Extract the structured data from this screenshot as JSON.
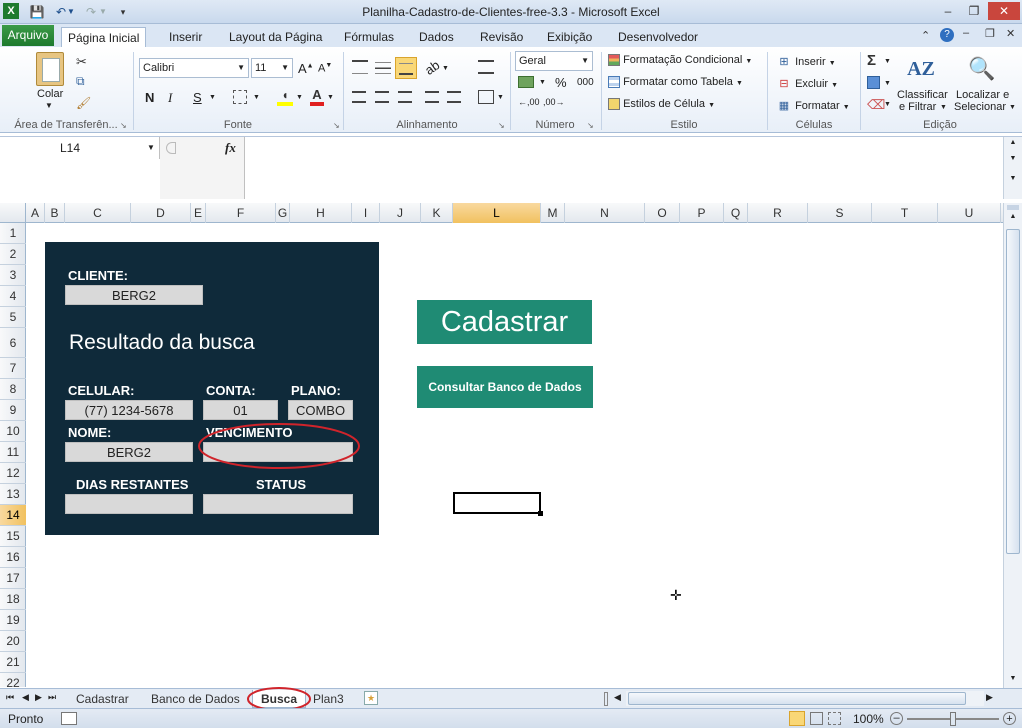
{
  "window": {
    "title": "Planilha-Cadastro-de-Clientes-free-3.3  -  Microsoft Excel",
    "minimize": "–",
    "restore": "❐",
    "close": "✕"
  },
  "ribbon_tabs": [
    "Página Inicial",
    "Inserir",
    "Layout da Página",
    "Fórmulas",
    "Dados",
    "Revisão",
    "Exibição",
    "Desenvolvedor"
  ],
  "file_tab": "Arquivo",
  "ribbon": {
    "clipboard": {
      "paste": "Colar",
      "label": "Área de Transferên..."
    },
    "font": {
      "name": "Calibri",
      "size": "11",
      "bold": "N",
      "italic": "I",
      "underline": "S",
      "label": "Fonte"
    },
    "alignment": {
      "label": "Alinhamento"
    },
    "number": {
      "format": "Geral",
      "percent": "%",
      "thousands": "000",
      "label": "Número"
    },
    "styles": {
      "conditional": "Formatação Condicional",
      "table": "Formatar como Tabela",
      "cell": "Estilos de Célula",
      "label": "Estilo"
    },
    "cells": {
      "insert": "Inserir",
      "delete": "Excluir",
      "format": "Formatar",
      "label": "Células"
    },
    "editing": {
      "sort1": "Classificar",
      "sort2": "e Filtrar",
      "find1": "Localizar e",
      "find2": "Selecionar",
      "label": "Edição"
    }
  },
  "formula_bar": {
    "name_box": "L14",
    "fx": "fx",
    "value": ""
  },
  "columns": [
    "A",
    "B",
    "C",
    "D",
    "E",
    "F",
    "G",
    "H",
    "I",
    "J",
    "K",
    "L",
    "M",
    "N",
    "O",
    "P",
    "Q",
    "R",
    "S",
    "T",
    "U"
  ],
  "rows": [
    "1",
    "2",
    "3",
    "4",
    "5",
    "6",
    "7",
    "8",
    "9",
    "10",
    "11",
    "12",
    "13",
    "14",
    "15",
    "16",
    "17",
    "18",
    "19",
    "20",
    "21",
    "22"
  ],
  "selected_column": "L",
  "selected_row": "14",
  "form": {
    "cliente_label": "CLIENTE:",
    "cliente_value": "BERG2",
    "result_title": "Resultado da busca",
    "celular_label": "CELULAR:",
    "celular_value": "(77) 1234-5678",
    "conta_label": "CONTA:",
    "conta_value": "01",
    "plano_label": "PLANO:",
    "plano_value": "COMBO",
    "nome_label": "NOME:",
    "nome_value": "BERG2",
    "vencimento_label": "VENCIMENTO",
    "vencimento_value": "",
    "dias_label": "DIAS RESTANTES",
    "dias_value": "",
    "status_label": "STATUS",
    "status_value": ""
  },
  "buttons": {
    "cadastrar": "Cadastrar",
    "consultar": "Consultar Banco de Dados"
  },
  "sheet_tabs": [
    "Cadastrar",
    "Banco de Dados",
    "Busca",
    "Plan3"
  ],
  "active_sheet": "Busca",
  "status": {
    "ready": "Pronto",
    "zoom": "100%"
  },
  "accent": {
    "panel": "#0f2a3a",
    "button": "#1f8b74",
    "annotation": "#d0242b"
  }
}
